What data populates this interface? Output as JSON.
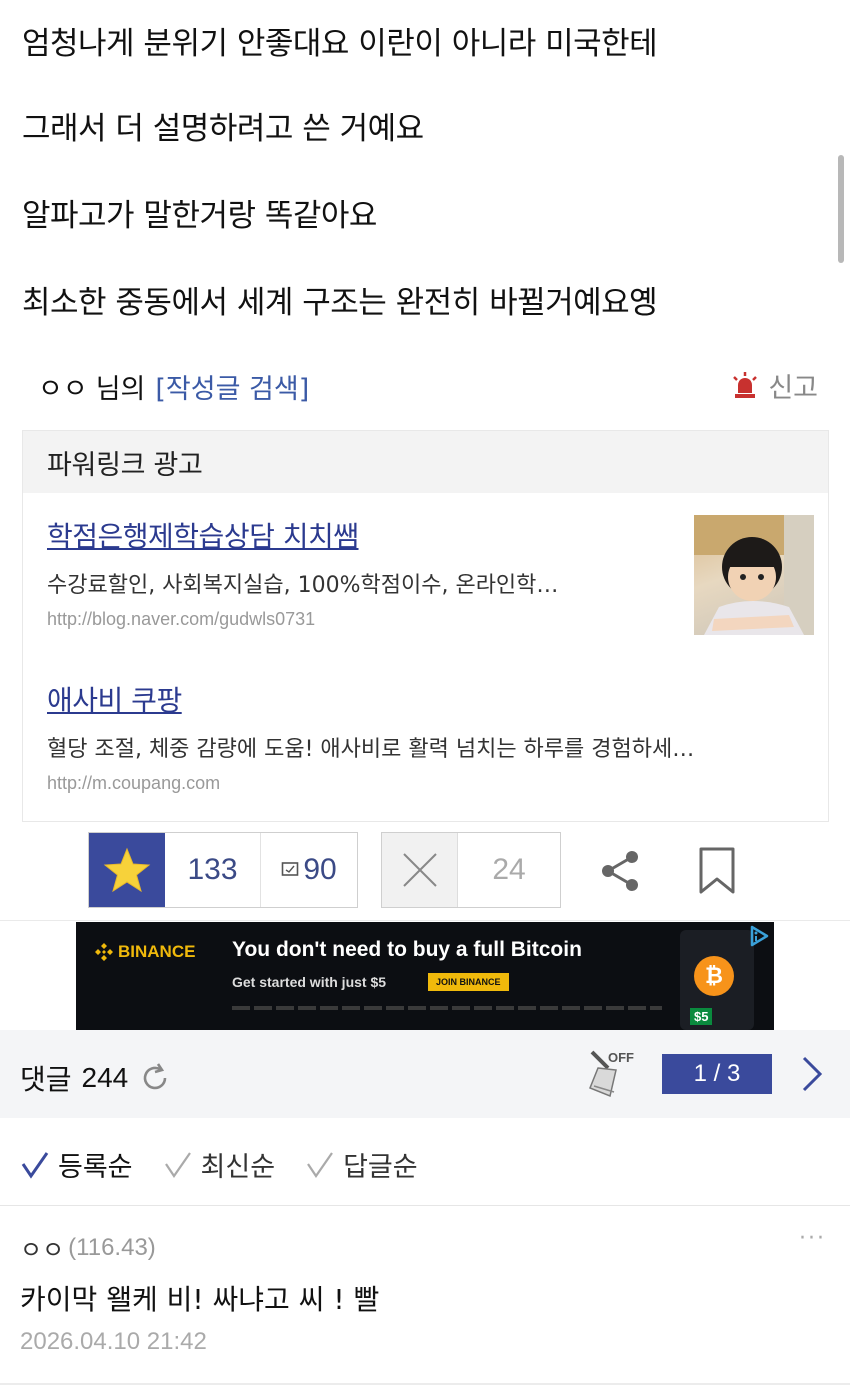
{
  "post": {
    "lines": [
      "엄청나게 분위기 안좋대요 이란이 아니라 미국한테",
      "그래서 더 설명하려고 쓴 거예요",
      "알파고가 말한거랑 똑같아요",
      "최소한 중동에서 세계 구조는 완전히 바뀔거예요옝"
    ]
  },
  "author_row": {
    "name": "ㅇㅇ",
    "suffix": "님의",
    "search_link": "[작성글 검색]",
    "report_label": "신고"
  },
  "powerlink": {
    "header": "파워링크 광고",
    "ads": [
      {
        "title": "학점은행제학습상담 치치쌤",
        "desc": "수강료할인, 사회복지실습, 100%학점이수, 온라인학…",
        "url": "http://blog.naver.com/gudwls0731"
      },
      {
        "title": "애사비 쿠팡",
        "desc": "혈당 조절, 체중 감량에 도움! 애사비로 활력 넘치는 하루를 경험하세…",
        "url": "http://m.coupang.com"
      }
    ]
  },
  "actions": {
    "recommend_count": "133",
    "comment_count": "90",
    "dislike_count": "24"
  },
  "banner": {
    "brand": "BINANCE",
    "headline": "You don't need to buy a full Bitcoin",
    "sub": "Get started with just $5",
    "button": "JOIN BINANCE",
    "badge": "$5"
  },
  "comments": {
    "label": "댓글",
    "count": "244",
    "filter_badge": "OFF",
    "pager": "1 / 3",
    "sort_options": [
      "등록순",
      "최신순",
      "답글순"
    ],
    "items": [
      {
        "author": "ㅇㅇ",
        "score": "(116.43)",
        "text": "카이막 왤케 비! 싸냐고 씨 ! 빨",
        "date": "2026.04.10 21:42",
        "more": "···"
      }
    ]
  },
  "colors": {
    "accent": "#3a4a9c",
    "link": "#2b3a8f",
    "report_icon": "#c8312f",
    "binance_yellow": "#f0b90b"
  }
}
